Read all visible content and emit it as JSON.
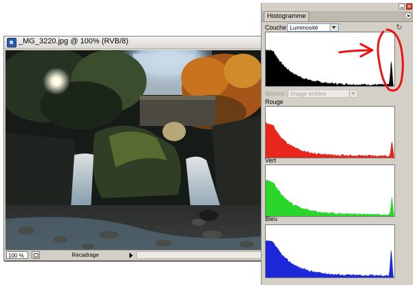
{
  "document": {
    "title": "_MG_3220.jpg @ 100% (RVB/8)",
    "zoom": "100 %",
    "status_text": "Recadrage"
  },
  "panel": {
    "tab_label": "Histogramme",
    "channel_label": "Couche :",
    "channel_value": "Luminosité",
    "source_label": "Source :",
    "source_value": "Image entière",
    "channels": [
      {
        "label": "Rouge",
        "color": "#e8261b"
      },
      {
        "label": "Vert",
        "color": "#2bd62b"
      },
      {
        "label": "Bleu",
        "color": "#1c28d8"
      }
    ],
    "luminosity_color": "#000000"
  },
  "annotation": {
    "color": "#ee1111",
    "shapes": [
      "arrow",
      "circle"
    ]
  },
  "icons": [
    "photoshop-doc-icon",
    "navigator-icon",
    "refresh-icon",
    "panel-menu-icon",
    "minimize-icon",
    "close-icon"
  ]
}
